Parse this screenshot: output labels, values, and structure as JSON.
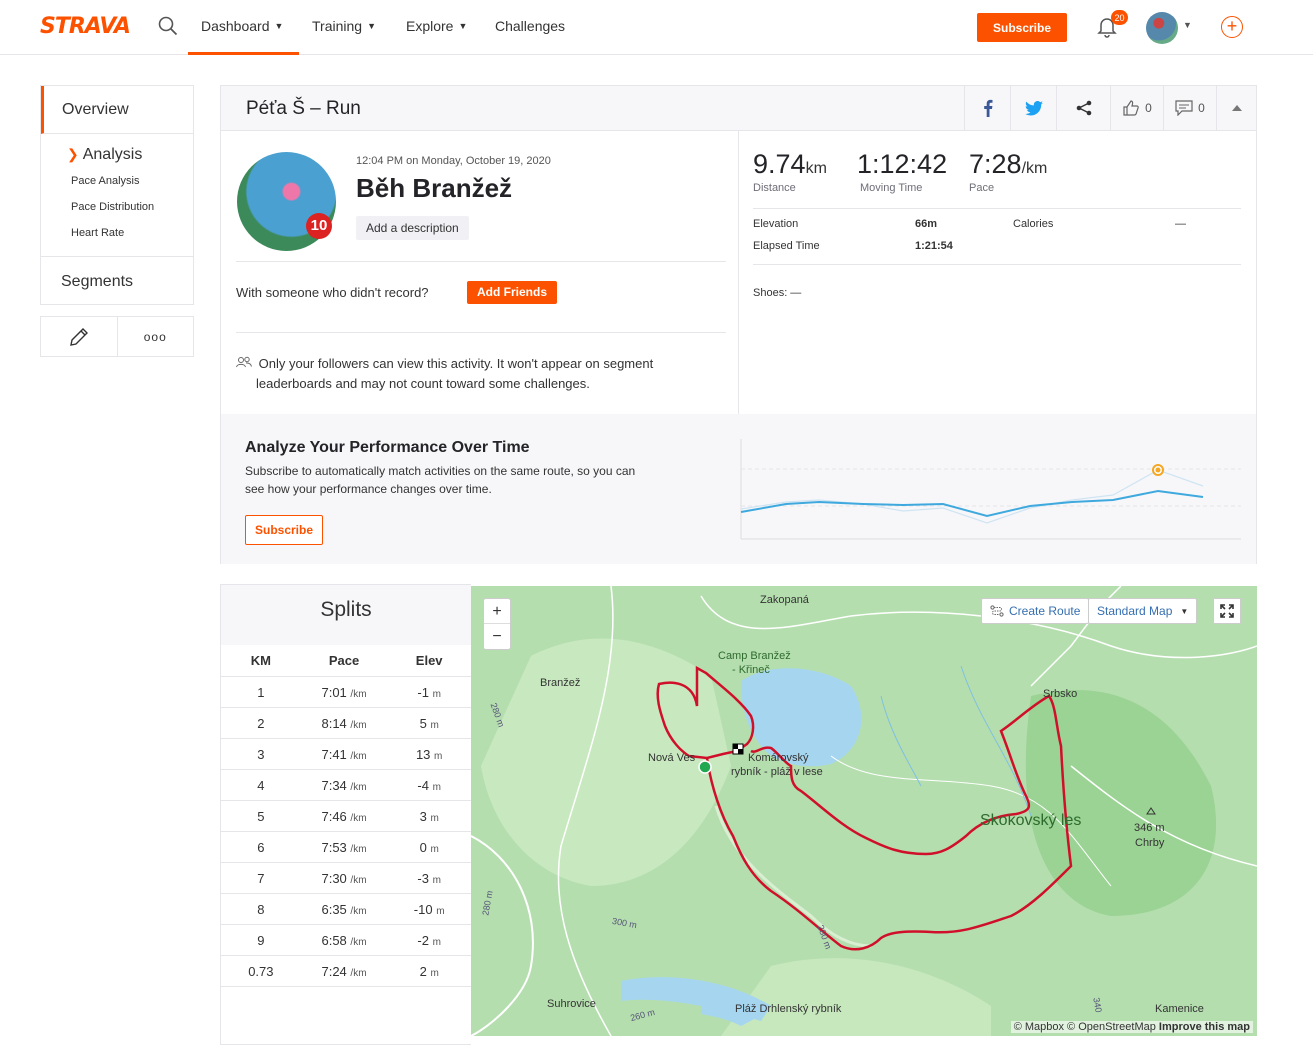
{
  "nav": {
    "logo": "STRAVA",
    "items": [
      {
        "label": "Dashboard",
        "has_chevron": true
      },
      {
        "label": "Training",
        "has_chevron": true
      },
      {
        "label": "Explore",
        "has_chevron": true
      },
      {
        "label": "Challenges",
        "has_chevron": false
      }
    ],
    "subscribe": "Subscribe",
    "notifications": "20",
    "brand_color": "#fc5200"
  },
  "sidebar": {
    "overview": "Overview",
    "analysis": "Analysis",
    "sub_items": [
      "Pace Analysis",
      "Pace Distribution",
      "Heart Rate"
    ],
    "segments": "Segments",
    "more": "ooo"
  },
  "activity": {
    "title": "Péťa Š – Run",
    "kudos": "0",
    "comments": "0",
    "date": "12:04 PM on Monday, October 19, 2020",
    "name": "Běh Branžež",
    "add_description": "Add a description",
    "someone_text": "With someone who didn't record?",
    "add_friends": "Add Friends",
    "privacy_line1": "Only your followers can view this activity. It won't appear on segment",
    "privacy_line2": "leaderboards and may not count toward some challenges.",
    "avatar_badge": "10"
  },
  "stats": {
    "distance": {
      "value": "9.74",
      "unit": "km",
      "label": "Distance"
    },
    "moving_time": {
      "value": "1:12:42",
      "unit": "",
      "label": "Moving Time"
    },
    "pace": {
      "value": "7:28",
      "unit": "/km",
      "label": "Pace"
    },
    "elevation_label": "Elevation",
    "elevation_value": "66m",
    "elapsed_label": "Elapsed Time",
    "elapsed_value": "1:21:54",
    "calories_label": "Calories",
    "calories_value": "—",
    "shoes": "Shoes: —"
  },
  "performance": {
    "title": "Analyze Your Performance Over Time",
    "text_line1": "Subscribe to automatically match activities on the same route, so you can",
    "text_line2": "see how your performance changes over time.",
    "button": "Subscribe"
  },
  "splits": {
    "title": "Splits",
    "headers": [
      "KM",
      "Pace",
      "Elev"
    ],
    "pace_unit": "/km",
    "elev_unit": "m",
    "rows": [
      {
        "km": "1",
        "pace": "7:01",
        "elev": "-1"
      },
      {
        "km": "2",
        "pace": "8:14",
        "elev": "5"
      },
      {
        "km": "3",
        "pace": "7:41",
        "elev": "13"
      },
      {
        "km": "4",
        "pace": "7:34",
        "elev": "-4"
      },
      {
        "km": "5",
        "pace": "7:46",
        "elev": "3"
      },
      {
        "km": "6",
        "pace": "7:53",
        "elev": "0"
      },
      {
        "km": "7",
        "pace": "7:30",
        "elev": "-3"
      },
      {
        "km": "8",
        "pace": "6:35",
        "elev": "-10"
      },
      {
        "km": "9",
        "pace": "6:58",
        "elev": "-2"
      },
      {
        "km": "0.73",
        "pace": "7:24",
        "elev": "2"
      }
    ]
  },
  "map": {
    "create_route": "Create Route",
    "map_type": "Standard Map",
    "zoom_in": "+",
    "zoom_out": "−",
    "labels": {
      "zakopana": "Zakopaná",
      "camp": "Camp Branžež",
      "krinec": "- Křineč",
      "branzez": "Branžež",
      "nova_ves": "Nová Ves",
      "komarovsky": "Komárovský",
      "rybnik": "rybník - pláž v lese",
      "srbsko": "Srbsko",
      "skokovsky": "Skokovský les",
      "chrby_m": "346 m",
      "chrby": "Chrby",
      "suhrovice": "Suhrovice",
      "plaz": "Pláž Drhlenský rybník",
      "kamenice": "Kamenice",
      "m280a": "280 m",
      "m280b": "280 m",
      "m300": "300 m",
      "m260": "260 m",
      "m280c": "280 m",
      "m340": "340"
    },
    "attribution": "© Mapbox © OpenStreetMap",
    "improve": "Improve this map"
  }
}
